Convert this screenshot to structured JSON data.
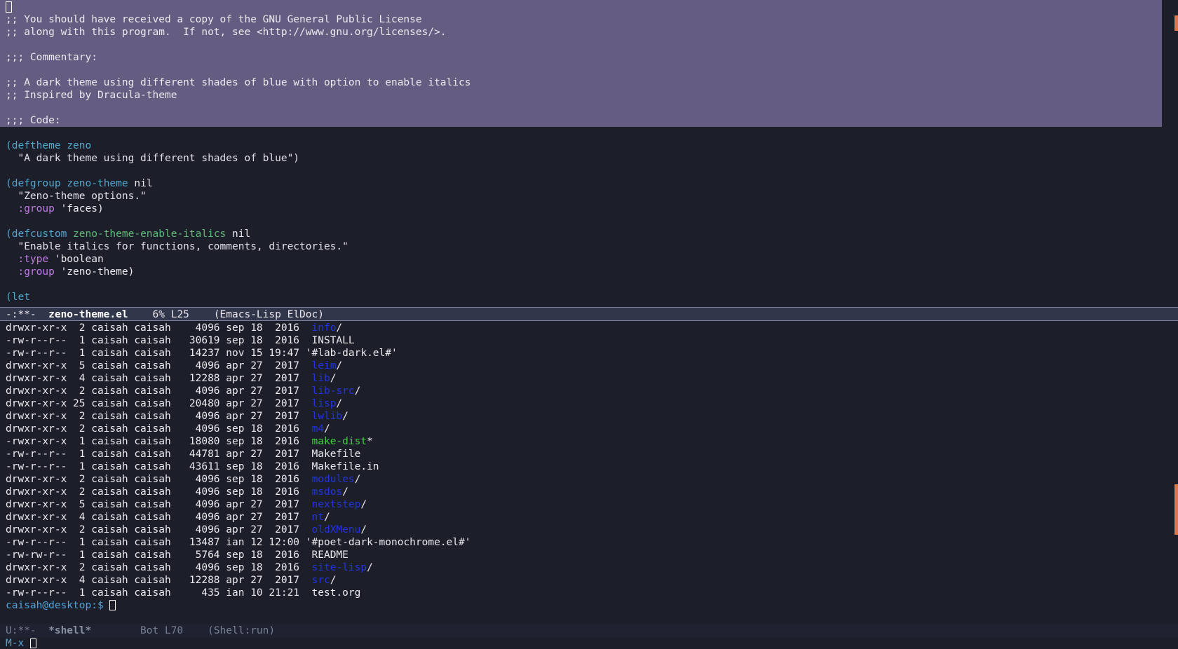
{
  "editor": {
    "region_lines": [
      ";; You should have received a copy of the GNU General Public License",
      ";; along with this program.  If not, see <http://www.gnu.org/licenses/>.",
      "",
      ";;; Commentary:",
      "",
      ";; A dark theme using different shades of blue with option to enable italics",
      ";; Inspired by Dracula-theme",
      "",
      ";;; Code:"
    ],
    "code": {
      "deftheme_kw": "(deftheme",
      "deftheme_name": "zeno",
      "deftheme_doc": "  \"A dark theme using different shades of blue\")",
      "defgroup_kw": "(defgroup",
      "defgroup_name": "zeno-theme",
      "defgroup_rest": " nil",
      "defgroup_doc": "  \"Zeno-theme options.\"",
      "defgroup_group_key": "  :group",
      "defgroup_group_val": " 'faces)",
      "defcustom_kw": "(defcustom",
      "defcustom_name": "zeno-theme-enable-italics",
      "defcustom_rest": " nil",
      "defcustom_doc": "  \"Enable italics for functions, comments, directories.\"",
      "defcustom_type_key": "  :type",
      "defcustom_type_val": " 'boolean",
      "defcustom_group_key": "  :group",
      "defcustom_group_val": " 'zeno-theme)",
      "let_kw": "(let"
    }
  },
  "modeline_top": {
    "status": "-:**-  ",
    "buffer": "zeno-theme.el",
    "position": "    6% L25    ",
    "modes": "(Emacs-Lisp ElDoc)"
  },
  "shell": {
    "rows": [
      {
        "meta": "drwxr-xr-x  2 caisah caisah    4096 sep 18  2016  ",
        "name": "info",
        "kind": "dir",
        "suffix": "/"
      },
      {
        "meta": "-rw-r--r--  1 caisah caisah   30619 sep 18  2016  ",
        "name": "INSTALL",
        "kind": "file",
        "suffix": ""
      },
      {
        "meta": "-rw-r--r--  1 caisah caisah   14237 nov 15 19:47 ",
        "name": "'#lab-dark.el#'",
        "kind": "file",
        "suffix": ""
      },
      {
        "meta": "drwxr-xr-x  5 caisah caisah    4096 apr 27  2017  ",
        "name": "leim",
        "kind": "dir",
        "suffix": "/"
      },
      {
        "meta": "drwxr-xr-x  4 caisah caisah   12288 apr 27  2017  ",
        "name": "lib",
        "kind": "dir",
        "suffix": "/"
      },
      {
        "meta": "drwxr-xr-x  2 caisah caisah    4096 apr 27  2017  ",
        "name": "lib-src",
        "kind": "dir",
        "suffix": "/"
      },
      {
        "meta": "drwxr-xr-x 25 caisah caisah   20480 apr 27  2017  ",
        "name": "lisp",
        "kind": "dir",
        "suffix": "/"
      },
      {
        "meta": "drwxr-xr-x  2 caisah caisah    4096 apr 27  2017  ",
        "name": "lwlib",
        "kind": "dir",
        "suffix": "/"
      },
      {
        "meta": "drwxr-xr-x  2 caisah caisah    4096 sep 18  2016  ",
        "name": "m4",
        "kind": "dir",
        "suffix": "/"
      },
      {
        "meta": "-rwxr-xr-x  1 caisah caisah   18080 sep 18  2016  ",
        "name": "make-dist",
        "kind": "exe",
        "suffix": "*"
      },
      {
        "meta": "-rw-r--r--  1 caisah caisah   44781 apr 27  2017  ",
        "name": "Makefile",
        "kind": "file",
        "suffix": ""
      },
      {
        "meta": "-rw-r--r--  1 caisah caisah   43611 sep 18  2016  ",
        "name": "Makefile.in",
        "kind": "file",
        "suffix": ""
      },
      {
        "meta": "drwxr-xr-x  2 caisah caisah    4096 sep 18  2016  ",
        "name": "modules",
        "kind": "dir",
        "suffix": "/"
      },
      {
        "meta": "drwxr-xr-x  2 caisah caisah    4096 sep 18  2016  ",
        "name": "msdos",
        "kind": "dir",
        "suffix": "/"
      },
      {
        "meta": "drwxr-xr-x  5 caisah caisah    4096 apr 27  2017  ",
        "name": "nextstep",
        "kind": "dir",
        "suffix": "/"
      },
      {
        "meta": "drwxr-xr-x  4 caisah caisah    4096 apr 27  2017  ",
        "name": "nt",
        "kind": "dir",
        "suffix": "/"
      },
      {
        "meta": "drwxr-xr-x  2 caisah caisah    4096 apr 27  2017  ",
        "name": "oldXMenu",
        "kind": "dir",
        "suffix": "/"
      },
      {
        "meta": "-rw-r--r--  1 caisah caisah   13487 ian 12 12:00 ",
        "name": "'#poet-dark-monochrome.el#'",
        "kind": "file",
        "suffix": ""
      },
      {
        "meta": "-rw-rw-r--  1 caisah caisah    5764 sep 18  2016  ",
        "name": "README",
        "kind": "file",
        "suffix": ""
      },
      {
        "meta": "drwxr-xr-x  2 caisah caisah    4096 sep 18  2016  ",
        "name": "site-lisp",
        "kind": "dir",
        "suffix": "/"
      },
      {
        "meta": "drwxr-xr-x  4 caisah caisah   12288 apr 27  2017  ",
        "name": "src",
        "kind": "dir",
        "suffix": "/"
      },
      {
        "meta": "-rw-r--r--  1 caisah caisah     435 ian 10 21:21  ",
        "name": "test.org",
        "kind": "file",
        "suffix": ""
      }
    ],
    "prompt": "caisah@desktop:$ "
  },
  "modeline_bottom": {
    "status": "U:**-  ",
    "buffer": "*shell*",
    "position": "        Bot L70    ",
    "modes": "(Shell:run)"
  },
  "minibuffer": {
    "prompt": "M-x "
  },
  "colors": {
    "background": "#1c1f2a",
    "region": "#655c81",
    "keyword": "#53a7ce",
    "function_name": "#5fba76",
    "keyword_arg": "#c17be5",
    "directory": "#2233e0",
    "executable": "#3fcf3f",
    "scrollbar": "#d97a47"
  }
}
